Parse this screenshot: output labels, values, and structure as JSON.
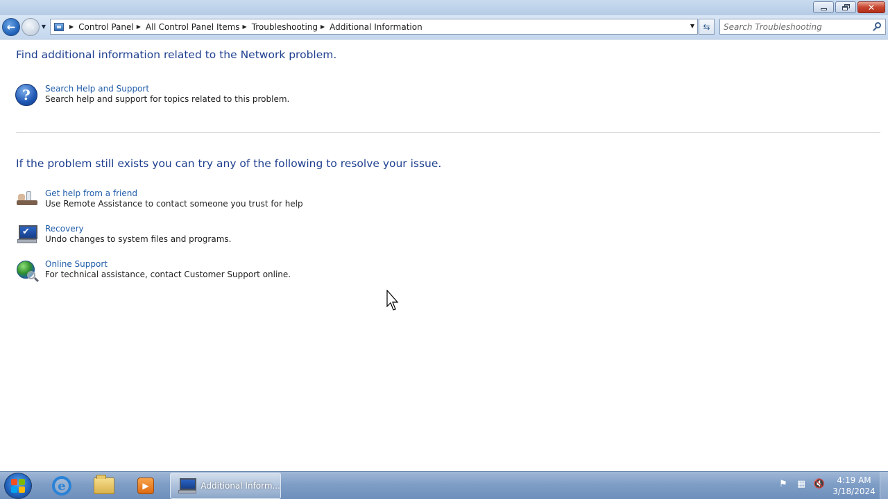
{
  "window": {
    "controls": {
      "minimize_icon": "minimize-icon",
      "maximize_icon": "restore-icon",
      "close_icon": "close-icon"
    }
  },
  "nav": {
    "back_icon": "back-arrow-icon",
    "forward_icon": "forward-arrow-icon",
    "breadcrumbs": [
      "Control Panel",
      "All Control Panel Items",
      "Troubleshooting",
      "Additional Information"
    ],
    "search_placeholder": "Search Troubleshooting"
  },
  "content": {
    "heading1": "Find additional information related to the Network problem.",
    "help_task": {
      "link": "Search Help and Support",
      "description": "Search help and support for topics related to this problem.",
      "icon": "help-icon"
    },
    "heading2": "If the problem still exists you can try any of the following to resolve your issue.",
    "tasks": [
      {
        "link": "Get help from a friend",
        "description": "Use Remote Assistance to contact someone you trust for help",
        "icon": "remote-assistance-icon"
      },
      {
        "link": "Recovery",
        "description": "Undo changes to system files and programs.",
        "icon": "recovery-icon"
      },
      {
        "link": "Online Support",
        "description": "For technical assistance, contact Customer Support online.",
        "icon": "online-support-icon"
      }
    ]
  },
  "taskbar": {
    "active_window_label": "Additional Inform...",
    "pinned": [
      "internet-explorer-icon",
      "windows-explorer-icon",
      "media-player-icon"
    ],
    "tray_icons": [
      "action-center-flag-icon",
      "network-icon",
      "volume-muted-icon"
    ],
    "clock_time": "4:19 AM",
    "clock_date": "3/18/2024"
  },
  "colors": {
    "heading": "#1e3f8f",
    "link": "#1e5ba8",
    "taskbar": "#7f9ec6"
  }
}
